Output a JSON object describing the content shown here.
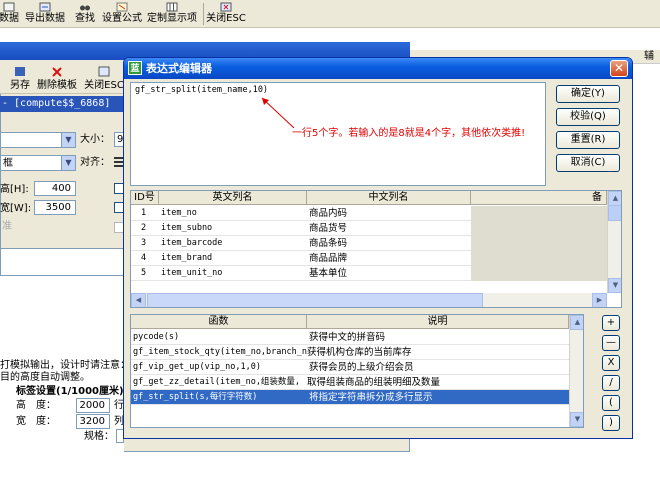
{
  "toolbar": {
    "items": [
      {
        "label": "数据",
        "icon": "import-icon"
      },
      {
        "label": "导出数据",
        "icon": "export-icon"
      },
      {
        "label": "查找",
        "icon": "binoculars-icon"
      },
      {
        "label": "设置公式",
        "icon": "formula-icon"
      },
      {
        "label": "定制显示项",
        "icon": "columns-icon"
      },
      {
        "label": "关闭ESC",
        "icon": "close-window-icon"
      }
    ]
  },
  "right_header": "辅",
  "background_window": {
    "toolbar": [
      {
        "label": "另存",
        "icon": "save-as-icon"
      },
      {
        "label": "删除模板",
        "icon": "delete-icon"
      },
      {
        "label": "关闭ESC",
        "icon": "close-icon"
      }
    ],
    "caption_left": "- [compute$$_6868]",
    "size_label": "大小：",
    "size_value": "9",
    "style_value": "框",
    "align_label": "对齐：",
    "height_label": "高[H]:",
    "height_value": "400",
    "width_label": "宽[W]:",
    "width_value": "3500",
    "faded_label": "准",
    "note_line1": "打模拟输出，设计时请注意：",
    "note_line2": "目的高度自动调整。",
    "label_settings_title": "标签设置(1/1000厘米)",
    "label_height_label": "高　度：",
    "label_height_value": "2000",
    "label_width_label": "宽　度：",
    "label_width_value": "3200",
    "row_suffix": "行",
    "col_suffix": "列",
    "spec_label": "规格："
  },
  "dialog": {
    "title": "表达式编辑器",
    "close_glyph": "✕",
    "expression": "gf_str_split(item_name,10)",
    "annotation": "一行5个字。若输入的是8就是4个字，其他依次类推!",
    "buttons": {
      "ok": "确定(Y)",
      "verify": "校验(Q)",
      "reset": "重置(R)",
      "cancel": "取消(C)"
    },
    "columns_grid": {
      "headers": [
        "ID号",
        "英文列名",
        "中文列名",
        "备"
      ],
      "rows": [
        {
          "id": "1",
          "en": "item_no",
          "cn": "商品内码"
        },
        {
          "id": "2",
          "en": "item_subno",
          "cn": "商品货号"
        },
        {
          "id": "3",
          "en": "item_barcode",
          "cn": "商品条码"
        },
        {
          "id": "4",
          "en": "item_brand",
          "cn": "商品品牌"
        },
        {
          "id": "5",
          "en": "item_unit_no",
          "cn": "基本单位"
        }
      ]
    },
    "functions_grid": {
      "headers": [
        "函数",
        "说明"
      ],
      "rows": [
        {
          "fn": "pycode(s)",
          "desc": "获得中文的拼音码"
        },
        {
          "fn": "gf_item_stock_qty(item_no,branch_no",
          "desc": "获得机构仓库的当前库存"
        },
        {
          "fn": "gf_vip_get_up(vip_no,1,0)",
          "desc": "获得会员的上级介绍会员"
        },
        {
          "fn": "gf_get_zz_detail(item_no,组装数量,",
          "desc": "取得组装商品的组装明细及数量"
        },
        {
          "fn": "gf_str_split(s,每行字符数)",
          "desc": "将指定字符串拆分成多行显示",
          "selected": true
        }
      ]
    },
    "operators": [
      "+",
      "—",
      "X",
      "/",
      "(",
      ")"
    ]
  }
}
